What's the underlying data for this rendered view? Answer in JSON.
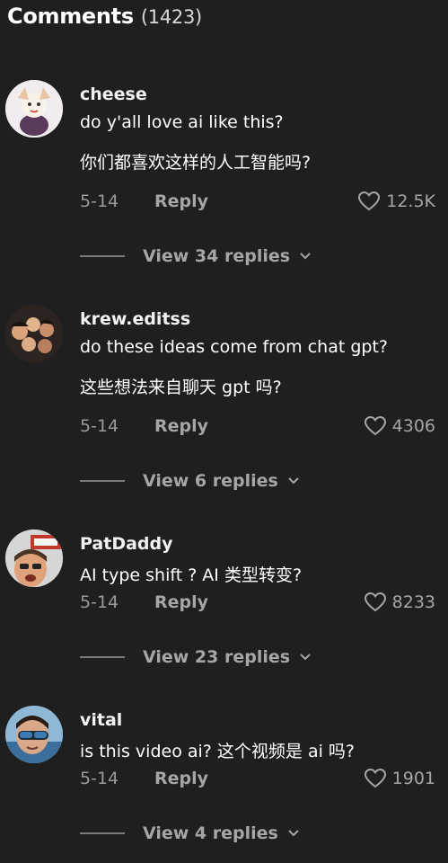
{
  "header": {
    "title": "Comments",
    "count": "(1423)"
  },
  "comments": [
    {
      "username": "cheese",
      "lines": [
        "do y'all love ai like this?",
        "你们都喜欢这样的人工智能吗?"
      ],
      "date": "5-14",
      "reply_label": "Reply",
      "likes": "12.5K",
      "view_replies": "View 34 replies"
    },
    {
      "username": "krew.editss",
      "lines": [
        "do these ideas come from chat gpt?",
        "这些想法来自聊天 gpt 吗?"
      ],
      "date": "5-14",
      "reply_label": "Reply",
      "likes": "4306",
      "view_replies": "View 6 replies"
    },
    {
      "username": "PatDaddy",
      "lines": [
        "AI type shift ? AI 类型转变?"
      ],
      "date": "5-14",
      "reply_label": "Reply",
      "likes": "8233",
      "view_replies": "View 23 replies"
    },
    {
      "username": "vital",
      "lines": [
        "is this video ai? 这个视频是 ai 吗?"
      ],
      "date": "5-14",
      "reply_label": "Reply",
      "likes": "1901",
      "view_replies": "View 4 replies"
    }
  ],
  "icons": {
    "like": "heart-outline-icon",
    "expand": "chevron-down-icon"
  },
  "colors": {
    "background": "#1f1f1f",
    "secondary_text": "#a6a6a6"
  }
}
